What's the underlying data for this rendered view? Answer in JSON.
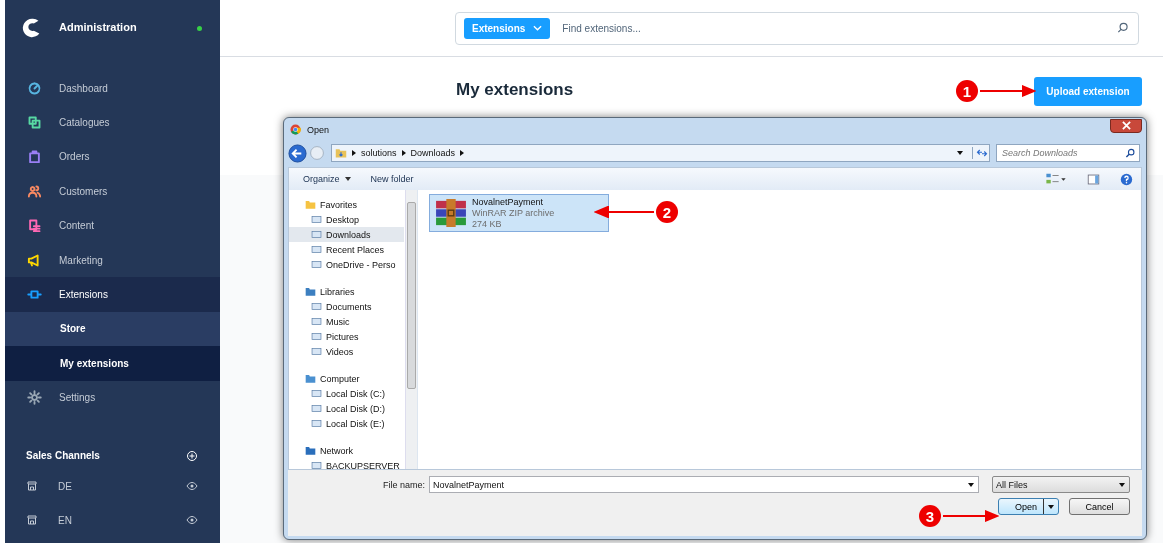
{
  "sidebar": {
    "title": "Administration",
    "items": [
      {
        "label": "Dashboard",
        "color": "#57b5e0",
        "selected": false
      },
      {
        "label": "Catalogues",
        "color": "#57d9a3",
        "selected": false
      },
      {
        "label": "Orders",
        "color": "#9a7ff5",
        "selected": false
      },
      {
        "label": "Customers",
        "color": "#f88962",
        "selected": false
      },
      {
        "label": "Content",
        "color": "#ff68b4",
        "selected": false
      },
      {
        "label": "Marketing",
        "color": "#ffd700",
        "selected": false
      },
      {
        "label": "Extensions",
        "color": "#189eff",
        "selected": true,
        "children": [
          {
            "label": "Store",
            "selected": false
          },
          {
            "label": "My extensions",
            "selected": true
          }
        ]
      },
      {
        "label": "Settings",
        "color": "#9aa8b5",
        "selected": false
      }
    ],
    "sales_channels": {
      "title": "Sales Channels",
      "items": [
        {
          "label": "DE"
        },
        {
          "label": "EN"
        }
      ]
    }
  },
  "header": {
    "search": {
      "category": "Extensions",
      "placeholder": "Find extensions..."
    }
  },
  "page": {
    "title": "My extensions",
    "upload_button": "Upload extension"
  },
  "dialog": {
    "title": "Open",
    "breadcrumb": [
      "solutions",
      "Downloads"
    ],
    "search_placeholder": "Search Downloads",
    "toolbar": [
      "Organize",
      "New folder"
    ],
    "nav": [
      {
        "label": "Favorites",
        "children": [
          {
            "label": "Desktop",
            "selected": false
          },
          {
            "label": "Downloads",
            "selected": true
          },
          {
            "label": "Recent Places",
            "selected": false
          },
          {
            "label": "OneDrive - Perso",
            "selected": false
          }
        ]
      },
      {
        "label": "Libraries",
        "children": [
          {
            "label": "Documents",
            "selected": false
          },
          {
            "label": "Music",
            "selected": false
          },
          {
            "label": "Pictures",
            "selected": false
          },
          {
            "label": "Videos",
            "selected": false
          }
        ]
      },
      {
        "label": "Computer",
        "children": [
          {
            "label": "Local Disk (C:)",
            "selected": false
          },
          {
            "label": "Local Disk (D:)",
            "selected": false
          },
          {
            "label": "Local Disk (E:)",
            "selected": false
          }
        ]
      },
      {
        "label": "Network",
        "children": [
          {
            "label": "BACKUPSERVER",
            "selected": false
          }
        ]
      }
    ],
    "files": [
      {
        "name": "NovalnetPayment",
        "type": "WinRAR ZIP archive",
        "size": "274 KB",
        "selected": true
      }
    ],
    "file_name_label": "File name:",
    "file_name": "NovalnetPayment",
    "file_type": "All Files",
    "open_button": "Open",
    "cancel_button": "Cancel"
  },
  "callouts": [
    "1",
    "2",
    "3"
  ]
}
